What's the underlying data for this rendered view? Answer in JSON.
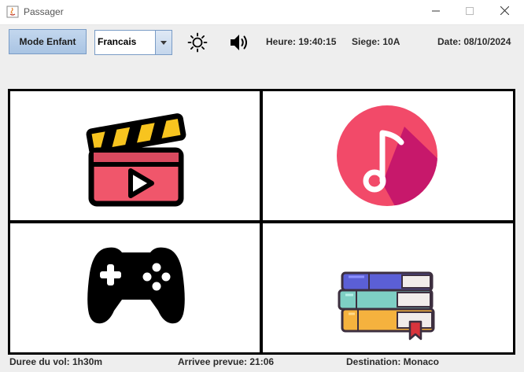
{
  "window": {
    "title": "Passager"
  },
  "toolbar": {
    "mode_button": "Mode Enfant",
    "language": {
      "selected": "Francais"
    },
    "heure": "Heure: 19:40:15",
    "siege": "Siege: 10A",
    "date": "Date: 08/10/2024"
  },
  "tiles": [
    {
      "icon": "clapperboard-icon"
    },
    {
      "icon": "music-note-icon"
    },
    {
      "icon": "gamepad-icon"
    },
    {
      "icon": "books-icon"
    }
  ],
  "footer": {
    "duree": "Duree du vol: 1h30m",
    "arrivee": "Arrivee prevue: 21:06",
    "destination": "Destination: Monaco"
  },
  "colors": {
    "clapper_red": "#f0566b",
    "clapper_yellow": "#f7c41f",
    "music_circle": "#f24a69",
    "music_shadow": "#c7186b",
    "button_blue": "#b8cfea"
  }
}
